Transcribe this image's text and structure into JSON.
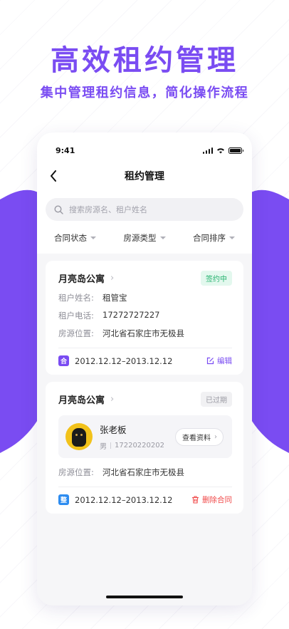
{
  "hero": {
    "title": "高效租约管理",
    "subtitle": "集中管理租约信息，简化操作流程"
  },
  "status_bar": {
    "time": "9:41"
  },
  "nav": {
    "title": "租约管理",
    "back_icon": "chevron-left-icon"
  },
  "search": {
    "placeholder": "搜索房源名、租户姓名",
    "icon": "search-icon"
  },
  "filters": [
    {
      "label": "合同状态"
    },
    {
      "label": "房源类型"
    },
    {
      "label": "合同排序"
    }
  ],
  "leases": [
    {
      "property": "月亮岛公寓",
      "status": "签约中",
      "status_color": "#23b26d",
      "tenant_name_label": "租户姓名:",
      "tenant_name": "租管宝",
      "tenant_phone_label": "租户电话:",
      "tenant_phone": "17272727227",
      "location_label": "房源位置:",
      "location": "河北省石家庄市无极县",
      "type_tag": "合",
      "period": "2012.12.12–2013.12.12",
      "action": "编辑"
    },
    {
      "property": "月亮岛公寓",
      "status": "已过期",
      "tenant": {
        "name": "张老板",
        "gender": "男",
        "phone": "17220220202",
        "view_label": "查看资料"
      },
      "location_label": "房源位置:",
      "location": "河北省石家庄市无极县",
      "type_tag": "整",
      "period": "2012.12.12–2013.12.12",
      "action": "删除合同"
    }
  ],
  "colors": {
    "accent": "#7a4cf2",
    "danger": "#f04848",
    "tag_blue": "#2d8cf0"
  }
}
